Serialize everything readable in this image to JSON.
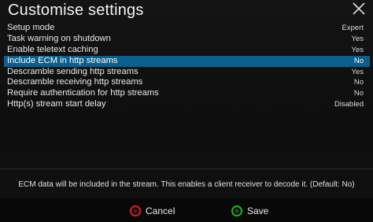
{
  "window": {
    "title": "Customise settings"
  },
  "settings": [
    {
      "label": "Setup mode",
      "value": "Expert"
    },
    {
      "label": "Task warning on shutdown",
      "value": "Yes"
    },
    {
      "label": "Enable teletext caching",
      "value": "Yes"
    },
    {
      "label": "Include ECM in http streams",
      "value": "No",
      "selected": true
    },
    {
      "label": "Descramble sending http streams",
      "value": "Yes"
    },
    {
      "label": "Descramble receiving http streams",
      "value": "No"
    },
    {
      "label": "Require authentication for http streams",
      "value": "No"
    },
    {
      "label": "Http(s) stream start delay",
      "value": "Disabled"
    }
  ],
  "description": "ECM data will be included in the stream. This enables a client receiver to decode it. (Default: No)",
  "buttons": {
    "cancel_label": "Cancel",
    "save_label": "Save"
  },
  "colors": {
    "selection": "#0b5f8c",
    "cancel_dot": "#d42323",
    "save_dot": "#21b321"
  },
  "icons": {
    "close": "close-icon",
    "cancel": "red-button-icon",
    "save": "green-button-icon"
  }
}
